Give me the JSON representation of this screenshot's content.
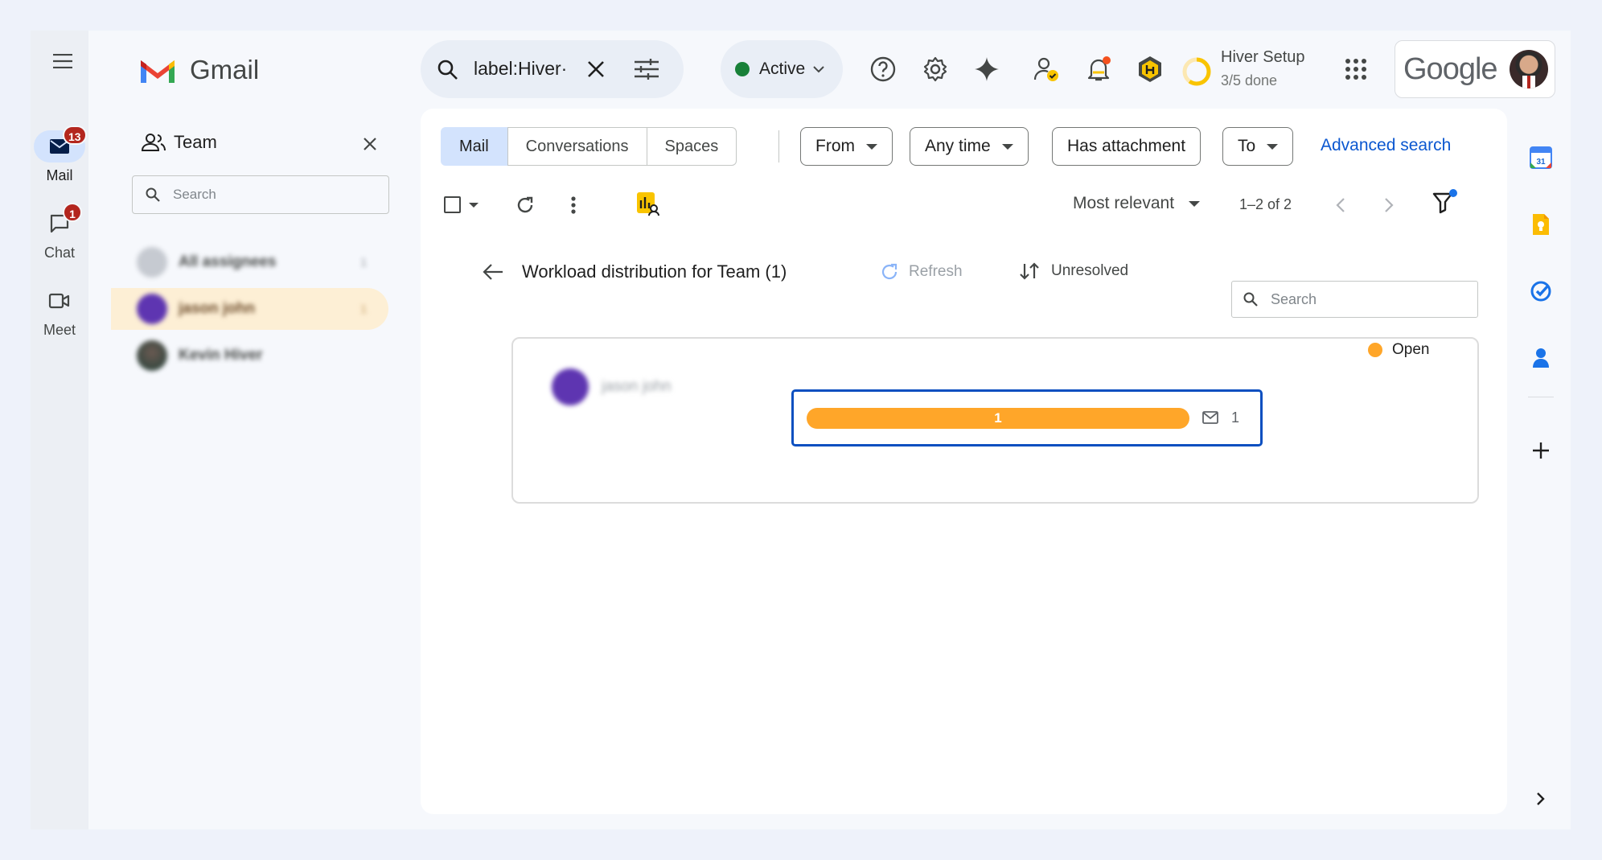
{
  "rail": {
    "mail": {
      "label": "Mail",
      "badge": "13"
    },
    "chat": {
      "label": "Chat",
      "badge": "1"
    },
    "meet": {
      "label": "Meet"
    }
  },
  "header": {
    "logo_text": "Gmail",
    "search_value": "label:Hiver·",
    "status_label": "Active",
    "hiver_setup": {
      "title": "Hiver Setup",
      "progress_text": "3/5 done",
      "progress_fraction": 0.6
    },
    "google_text": "Google"
  },
  "team_panel": {
    "title": "Team",
    "search_placeholder": "Search",
    "assignees": [
      {
        "name": "All assignees",
        "count": "1"
      },
      {
        "name": "jason john",
        "count": "1"
      },
      {
        "name": "Kevin Hiver",
        "count": ""
      }
    ]
  },
  "search_chips": {
    "tabs": [
      "Mail",
      "Conversations",
      "Spaces"
    ],
    "filters": [
      "From",
      "Any time",
      "Has attachment",
      "To"
    ],
    "advanced": "Advanced search"
  },
  "toolbar": {
    "sort_label": "Most relevant",
    "page_range": "1–2 of 2"
  },
  "workload": {
    "title": "Workload distribution for Team (1)",
    "refresh_label": "Refresh",
    "status_filter": "Unresolved",
    "search_placeholder": "Search",
    "legend": "Open",
    "rows": [
      {
        "name": "jason john",
        "open": "1",
        "total": "1"
      }
    ]
  },
  "colors": {
    "open": "#ffa629",
    "accent": "#0b57d0",
    "selected_box": "#0b4fc0"
  }
}
